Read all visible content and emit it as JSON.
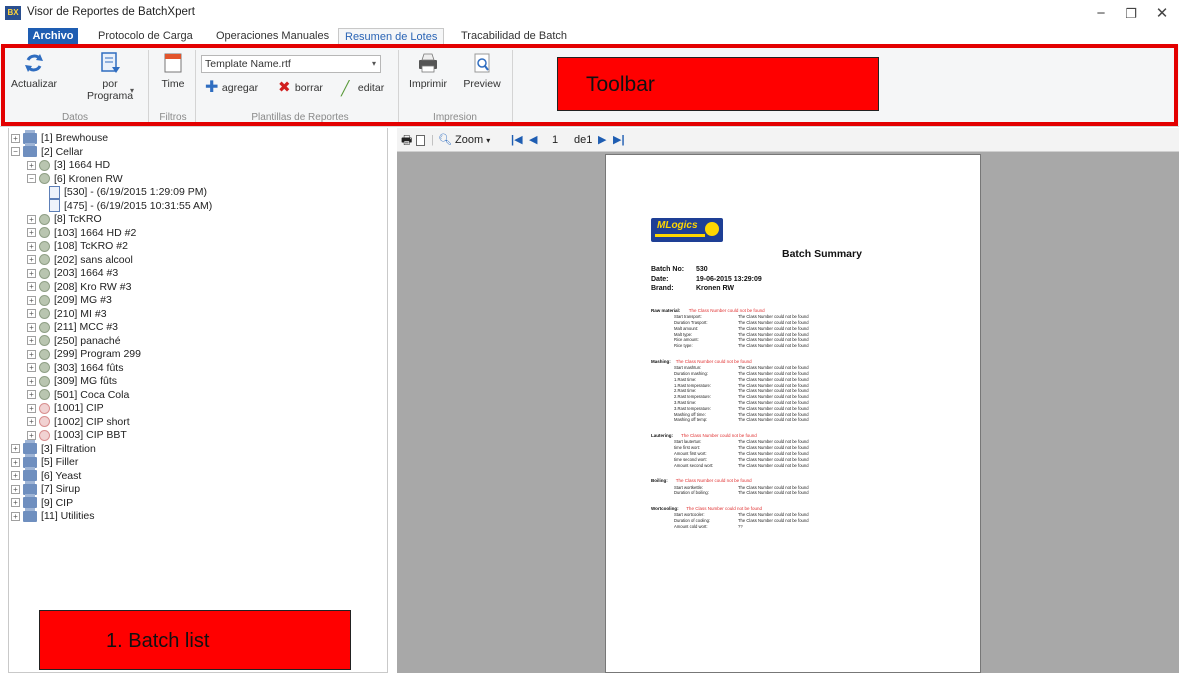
{
  "window": {
    "app_icon": "BX",
    "title": "Visor de Reportes de BatchXpert",
    "controls": {
      "minimize": "−",
      "maximize": "❐",
      "close": "✕"
    }
  },
  "tabs": {
    "file": "Archivo",
    "items": [
      "Protocolo de Carga",
      "Operaciones Manuales",
      "Resumen de Lotes",
      "Tracabilidad de Batch"
    ],
    "active_index": 2
  },
  "ribbon": {
    "actualizar": "Actualizar",
    "por_programa_1": "por",
    "por_programa_2": "Programa",
    "time": "Time",
    "template_combo": "Template Name.rtf",
    "agregar": "agregar",
    "borrar": "borrar",
    "editar": "editar",
    "imprimir": "Imprimir",
    "preview": "Preview",
    "groups": {
      "datos": "Datos",
      "filtros": "Filtros",
      "plantillas": "Plantillas de Reportes",
      "impresion": "Impresion"
    }
  },
  "callouts": {
    "toolbar": "Toolbar",
    "batch_list": "1.   Batch list"
  },
  "tree": {
    "rows": [
      {
        "label": "[1] Brewhouse",
        "type": "folder",
        "level": 0,
        "exp": "+"
      },
      {
        "label": "[2] Cellar",
        "type": "folder",
        "level": 0,
        "exp": "−"
      },
      {
        "label": "[3] 1664 HD",
        "type": "leaf",
        "level": 1,
        "exp": "+"
      },
      {
        "label": "[6] Kronen RW",
        "type": "leaf",
        "level": 1,
        "exp": "−"
      },
      {
        "label": "[530] - (6/19/2015 1:29:09 PM)",
        "type": "doc",
        "level": 2,
        "exp": ""
      },
      {
        "label": "[475] - (6/19/2015 10:31:55 AM)",
        "type": "doc",
        "level": 2,
        "exp": ""
      },
      {
        "label": "[8] TcKRO",
        "type": "leaf",
        "level": 1,
        "exp": "+"
      },
      {
        "label": "[103] 1664 HD #2",
        "type": "leaf",
        "level": 1,
        "exp": "+"
      },
      {
        "label": "[108] TcKRO #2",
        "type": "leaf",
        "level": 1,
        "exp": "+"
      },
      {
        "label": "[202] sans alcool",
        "type": "leaf",
        "level": 1,
        "exp": "+"
      },
      {
        "label": "[203] 1664  #3",
        "type": "leaf",
        "level": 1,
        "exp": "+"
      },
      {
        "label": "[208] Kro RW #3",
        "type": "leaf",
        "level": 1,
        "exp": "+"
      },
      {
        "label": "[209] MG #3",
        "type": "leaf",
        "level": 1,
        "exp": "+"
      },
      {
        "label": "[210] MI #3",
        "type": "leaf",
        "level": 1,
        "exp": "+"
      },
      {
        "label": "[211] MCC #3",
        "type": "leaf",
        "level": 1,
        "exp": "+"
      },
      {
        "label": "[250] panaché",
        "type": "leaf",
        "level": 1,
        "exp": "+"
      },
      {
        "label": "[299] Program 299",
        "type": "leaf",
        "level": 1,
        "exp": "+"
      },
      {
        "label": "[303] 1664 fûts",
        "type": "leaf",
        "level": 1,
        "exp": "+"
      },
      {
        "label": "[309] MG fûts",
        "type": "leaf",
        "level": 1,
        "exp": "+"
      },
      {
        "label": "[501] Coca Cola",
        "type": "leaf",
        "level": 1,
        "exp": "+"
      },
      {
        "label": "[1001] CIP",
        "type": "leaf-red",
        "level": 1,
        "exp": "+"
      },
      {
        "label": "[1002] CIP short",
        "type": "leaf-red",
        "level": 1,
        "exp": "+"
      },
      {
        "label": "[1003] CIP BBT",
        "type": "leaf-red",
        "level": 1,
        "exp": "+"
      },
      {
        "label": "[3] Filtration",
        "type": "folder",
        "level": 0,
        "exp": "+"
      },
      {
        "label": "[5] Filler",
        "type": "folder",
        "level": 0,
        "exp": "+"
      },
      {
        "label": "[6] Yeast",
        "type": "folder",
        "level": 0,
        "exp": "+"
      },
      {
        "label": "[7] Sirup",
        "type": "folder",
        "level": 0,
        "exp": "+"
      },
      {
        "label": "[9] CIP",
        "type": "folder",
        "level": 0,
        "exp": "+"
      },
      {
        "label": "[11] Utilities",
        "type": "folder",
        "level": 0,
        "exp": "+"
      }
    ]
  },
  "report_toolbar": {
    "zoom": "Zoom",
    "page_num": "1",
    "page_of": "de1"
  },
  "report": {
    "logo": "MLogics",
    "title": "Batch Summary",
    "meta": [
      {
        "k": "Batch No:",
        "v": "530"
      },
      {
        "k": "Date:",
        "v": "19-06-2015 13:29:09"
      },
      {
        "k": "Brand:",
        "v": "Kronen RW"
      }
    ],
    "not_found": "The Class Number could not be found",
    "sections": [
      {
        "name": "Raw material:",
        "rows": [
          "Start transport:",
          "Duration Trasport:",
          "Malt amount:",
          "Malt type:",
          "Rice amount:",
          "Rice type:"
        ]
      },
      {
        "name": "Mashing:",
        "rows": [
          "Start mashtun:",
          "Duration mashing:",
          "1.Rast time:",
          "1.Rast temperature:",
          "2.Rast time:",
          "2.Rast temperature:",
          "3.Rast time:",
          "3.Rast temperature:",
          "Mashing off time:",
          "Mashing off temp:"
        ]
      },
      {
        "name": "Lautering:",
        "rows": [
          "Start lautertun:",
          "time first wort:",
          "Amount first wort:",
          "time second wort:",
          "Amount second wort:"
        ]
      },
      {
        "name": "Boiling:",
        "rows": [
          "Start wortkettle:",
          "Duration of boiling:"
        ]
      },
      {
        "name": "Wortcooling:",
        "rows": [
          "Start wortcooler:",
          "Duration of cooling:",
          "Amount cold wort:"
        ]
      }
    ],
    "last_value": "??"
  }
}
